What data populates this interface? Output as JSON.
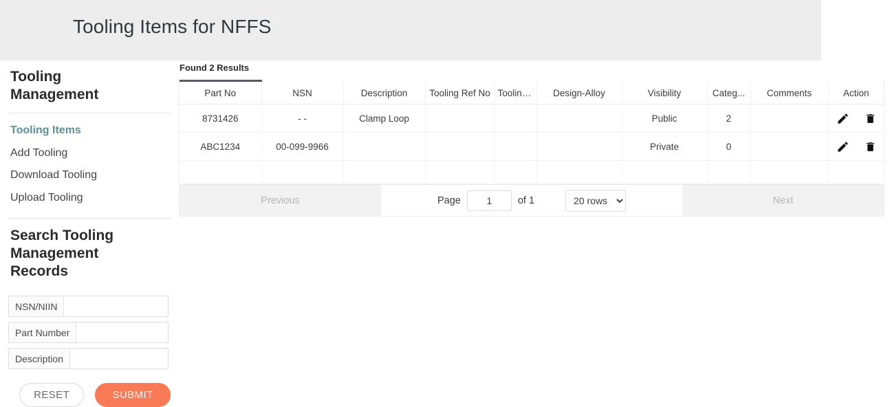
{
  "header": {
    "title": "Tooling Items for NFFS"
  },
  "sidebar": {
    "heading": "Tooling Management",
    "nav": [
      {
        "label": "Tooling Items",
        "active": true
      },
      {
        "label": "Add Tooling",
        "active": false
      },
      {
        "label": "Download Tooling",
        "active": false
      },
      {
        "label": "Upload Tooling",
        "active": false
      }
    ],
    "search_heading": "Search Tooling Management Records",
    "fields": [
      {
        "label": "NSN/NIIN",
        "value": "",
        "placeholder": ""
      },
      {
        "label": "Part Number",
        "value": "",
        "placeholder": ""
      },
      {
        "label": "Description",
        "value": "",
        "placeholder": ""
      }
    ],
    "reset_label": "RESET",
    "submit_label": "SUBMIT"
  },
  "results": {
    "count_text": "Found 2 Results",
    "columns": [
      {
        "label": "Part No",
        "sorted": true
      },
      {
        "label": "NSN",
        "sorted": false
      },
      {
        "label": "Description",
        "sorted": false
      },
      {
        "label": "Tooling Ref No",
        "sorted": false
      },
      {
        "label": "Tooling...",
        "sorted": false
      },
      {
        "label": "Design-Alloy",
        "sorted": false
      },
      {
        "label": "Visibility",
        "sorted": false
      },
      {
        "label": "Categ...",
        "sorted": false
      },
      {
        "label": "Comments",
        "sorted": false
      },
      {
        "label": "Action",
        "sorted": false
      }
    ],
    "rows": [
      {
        "part_no": "8731426",
        "nsn": "- -",
        "description": "Clamp Loop",
        "tooling_ref_no": "",
        "tooling": "",
        "design_alloy": "",
        "visibility": "Public",
        "category": "2",
        "comments": ""
      },
      {
        "part_no": "ABC1234",
        "nsn": "00-099-9966",
        "description": "",
        "tooling_ref_no": "",
        "tooling": "",
        "design_alloy": "",
        "visibility": "Private",
        "category": "0",
        "comments": ""
      }
    ],
    "edit_icon": "pencil-icon",
    "delete_icon": "trash-icon"
  },
  "pagination": {
    "previous_label": "Previous",
    "next_label": "Next",
    "page_label": "Page",
    "page_value": "1",
    "of_label": "of 1",
    "rows_selected": "20 rows",
    "rows_options": [
      "20 rows"
    ]
  },
  "colors": {
    "header_band": "#ededed",
    "accent_teal": "#5f9098",
    "submit_orange": "#f87a56",
    "sort_bar": "#555b60"
  }
}
